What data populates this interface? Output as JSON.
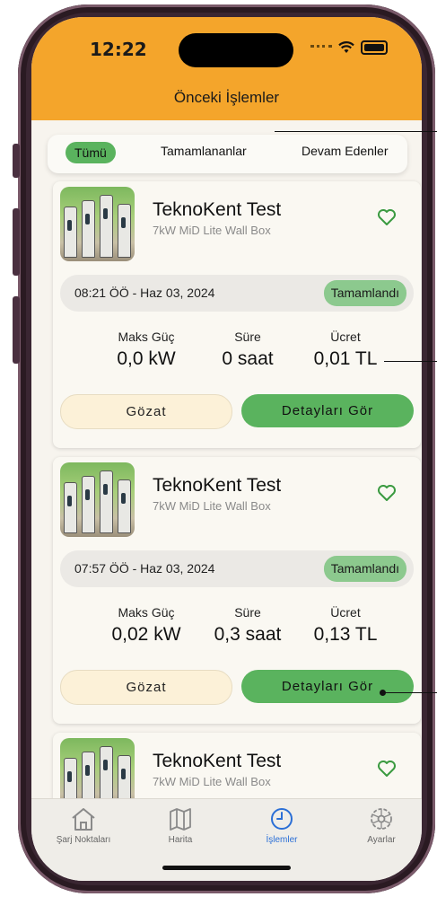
{
  "status_bar": {
    "time": "12:22"
  },
  "header": {
    "title": "Önceki İşlemler"
  },
  "tabs": [
    {
      "label": "Tümü",
      "active": true
    },
    {
      "label": "Tamamlananlar",
      "active": false
    },
    {
      "label": "Devam Edenler",
      "active": false
    }
  ],
  "cards": [
    {
      "station_name": "TeknoKent Test",
      "station_model": "7kW MiD Lite Wall Box",
      "datetime": "08:21 ÖÖ - Haz 03, 2024",
      "status": "Tamamlandı",
      "max_power_label": "Maks Güç",
      "max_power_value": "0,0 kW",
      "duration_label": "Süre",
      "duration_value": "0 saat",
      "fee_label": "Ücret",
      "fee_value": "0,01 TL",
      "browse_label": "Gözat",
      "details_label": "Detayları Gör"
    },
    {
      "station_name": "TeknoKent Test",
      "station_model": "7kW MiD Lite Wall Box",
      "datetime": "07:57 ÖÖ - Haz 03, 2024",
      "status": "Tamamlandı",
      "max_power_label": "Maks Güç",
      "max_power_value": "0,02 kW",
      "duration_label": "Süre",
      "duration_value": "0,3 saat",
      "fee_label": "Ücret",
      "fee_value": "0,13 TL",
      "browse_label": "Gözat",
      "details_label": "Detayları Gör"
    },
    {
      "station_name": "TeknoKent Test",
      "station_model": "7kW MiD Lite Wall Box"
    }
  ],
  "navbar": {
    "items": [
      {
        "label": "Şarj Noktaları",
        "icon": "home-icon",
        "active": false
      },
      {
        "label": "Harita",
        "icon": "map-icon",
        "active": false
      },
      {
        "label": "İşlemler",
        "icon": "clock-icon",
        "active": true
      },
      {
        "label": "Ayarlar",
        "icon": "gear-icon",
        "active": false
      }
    ]
  },
  "colors": {
    "header": "#f4a52b",
    "accent_green": "#5ab35e",
    "status_pill": "#8cc98e",
    "browse_button": "#fcf1d8",
    "active_nav": "#2b6fd6"
  }
}
